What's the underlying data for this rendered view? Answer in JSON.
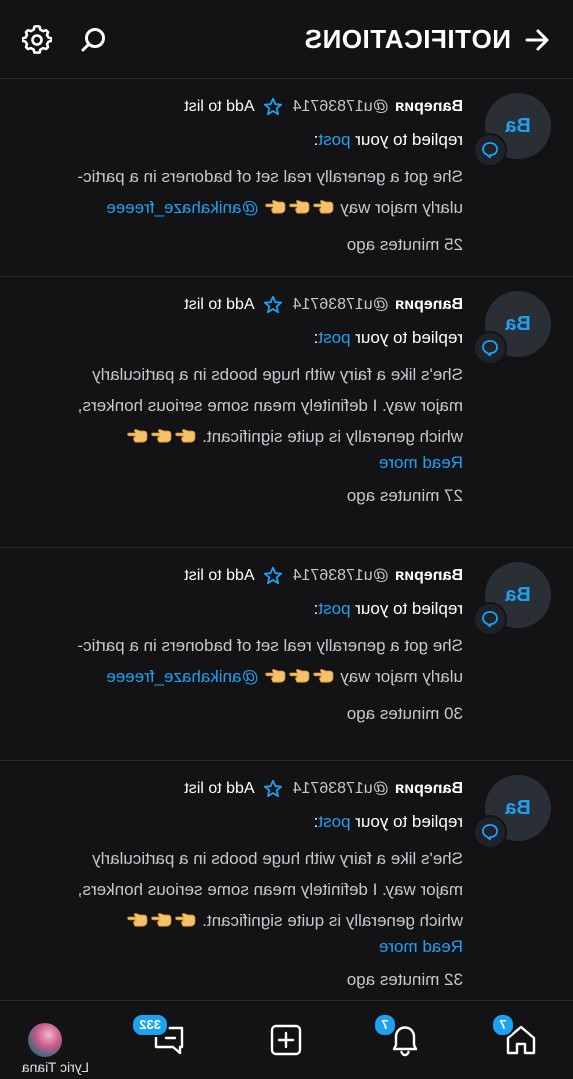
{
  "header": {
    "title": "NOTIFICATIONS"
  },
  "notifications": [
    {
      "avatar_initials": "Ba",
      "user_name": "Ваnерия",
      "handle": "@u17836714",
      "add_to_list": "Add to list",
      "action_prefix": "replied to your ",
      "action_link": "post",
      "action_suffix": ":",
      "text_line1": "She got a generally real set of badoners in a partic-",
      "text_line2": "ularly major way",
      "mention": "@anikahaze_freeee",
      "emoji_count": 3,
      "read_more": "",
      "time": "25 minutes ago"
    },
    {
      "avatar_initials": "Ba",
      "user_name": "Ваnерия",
      "handle": "@u17836714",
      "add_to_list": "Add to list",
      "action_prefix": "replied to your ",
      "action_link": "post",
      "action_suffix": ":",
      "text_line1": "She's like a fairy with huge boobs in a particularly",
      "text_line2": "major way. I definitely mean some serious honkers,",
      "text_line3": "which generally is quite significant.",
      "mention": "",
      "emoji_count": 3,
      "read_more": "Read more",
      "time": "27 minutes ago"
    },
    {
      "avatar_initials": "Ba",
      "user_name": "Ваnерия",
      "handle": "@u17836714",
      "add_to_list": "Add to list",
      "action_prefix": "replied to your ",
      "action_link": "post",
      "action_suffix": ":",
      "text_line1": "She got a generally real set of badoners in a partic-",
      "text_line2": "ularly major way",
      "mention": "@anikahaze_freeee",
      "emoji_count": 3,
      "read_more": "",
      "time": "30 minutes ago"
    },
    {
      "avatar_initials": "Ba",
      "user_name": "Ваnерия",
      "handle": "@u17836714",
      "add_to_list": "Add to list",
      "action_prefix": "replied to your ",
      "action_link": "post",
      "action_suffix": ":",
      "text_line1": "She's like a fairy with huge boobs in a particularly",
      "text_line2": "major way. I definitely mean some serious honkers,",
      "text_line3": "which generally is quite significant.",
      "mention": "",
      "emoji_count": 3,
      "read_more": "Read more",
      "time": "32 minutes ago"
    }
  ],
  "bottom_nav": {
    "home_badge": "7",
    "notifications_badge": "7",
    "messages_badge": "332",
    "profile_name": "Lyric Tiana"
  },
  "colors": {
    "background": "#131315",
    "accent": "#1da1f2",
    "divider": "#2c2c30",
    "muted_text": "#c7c7cc"
  },
  "icons": {
    "back": "arrow-left-icon",
    "search": "search-icon",
    "settings": "gear-icon",
    "star": "star-icon",
    "reply": "speech-bubble-icon",
    "home": "home-icon",
    "bell": "bell-icon",
    "create": "plus-square-icon",
    "messages": "chat-icon",
    "emoji": "backhand-index-pointing-right-emoji"
  }
}
